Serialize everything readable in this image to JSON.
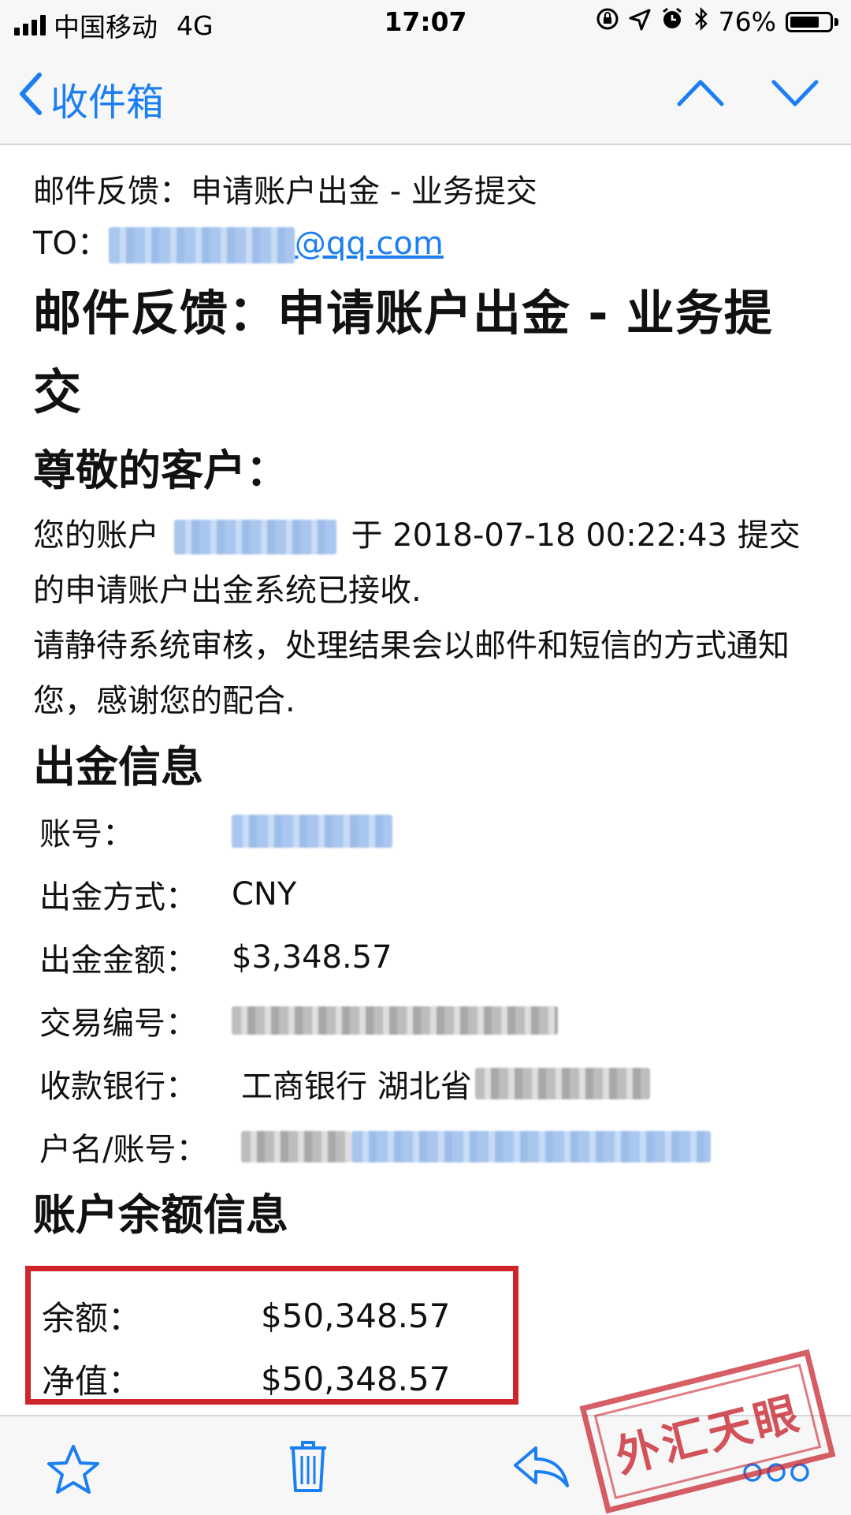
{
  "status_bar": {
    "carrier": "中国移动",
    "network": "4G",
    "time": "17:07",
    "battery": "76%",
    "battery_level": 0.76,
    "icons": [
      "signal-icon",
      "lock-rotation-icon",
      "location-icon",
      "alarm-icon",
      "bluetooth-icon",
      "battery-icon"
    ]
  },
  "nav": {
    "back_label": "收件箱",
    "icons": [
      "back-chevron-icon",
      "previous-message-icon",
      "next-message-icon"
    ]
  },
  "email": {
    "subject_line": "邮件反馈：申请账户出金 - 业务提交",
    "to_label": "TO：",
    "to_domain": "@qq.com",
    "heading": "邮件反馈：申请账户出金 - 业务提交",
    "greeting": "尊敬的客户：",
    "para1_prefix": "您的账户",
    "para1_suffix": "于 2018-07-18 00:22:43 提交的申请账户出金系统已接收.",
    "para2": "请静待系统审核，处理结果会以邮件和短信的方式通知您，感谢您的配合.",
    "withdraw_section": {
      "title": "出金信息",
      "account_label": "账号：",
      "method_label": "出金方式：",
      "method_value": "CNY",
      "amount_label": "出金金额：",
      "amount_value": "$3,348.57",
      "txn_label": "交易编号：",
      "bank_label": "收款银行：",
      "bank_value": "工商银行 湖北省",
      "name_label": "户名/账号："
    },
    "balance_section": {
      "title": "账户余额信息",
      "balance_label": "余额：",
      "balance_value": "$50,348.57",
      "equity_label": "净值：",
      "equity_value": "$50,348.57"
    }
  },
  "toolbar": {
    "icons": [
      "flag-star-icon",
      "trash-icon",
      "reply-icon",
      "more-icon"
    ]
  },
  "watermark": {
    "text": "外汇天眼"
  },
  "colors": {
    "accent": "#1b7ef2",
    "highlight_border": "#d0242c",
    "bar_background": "#f7f7f7"
  }
}
